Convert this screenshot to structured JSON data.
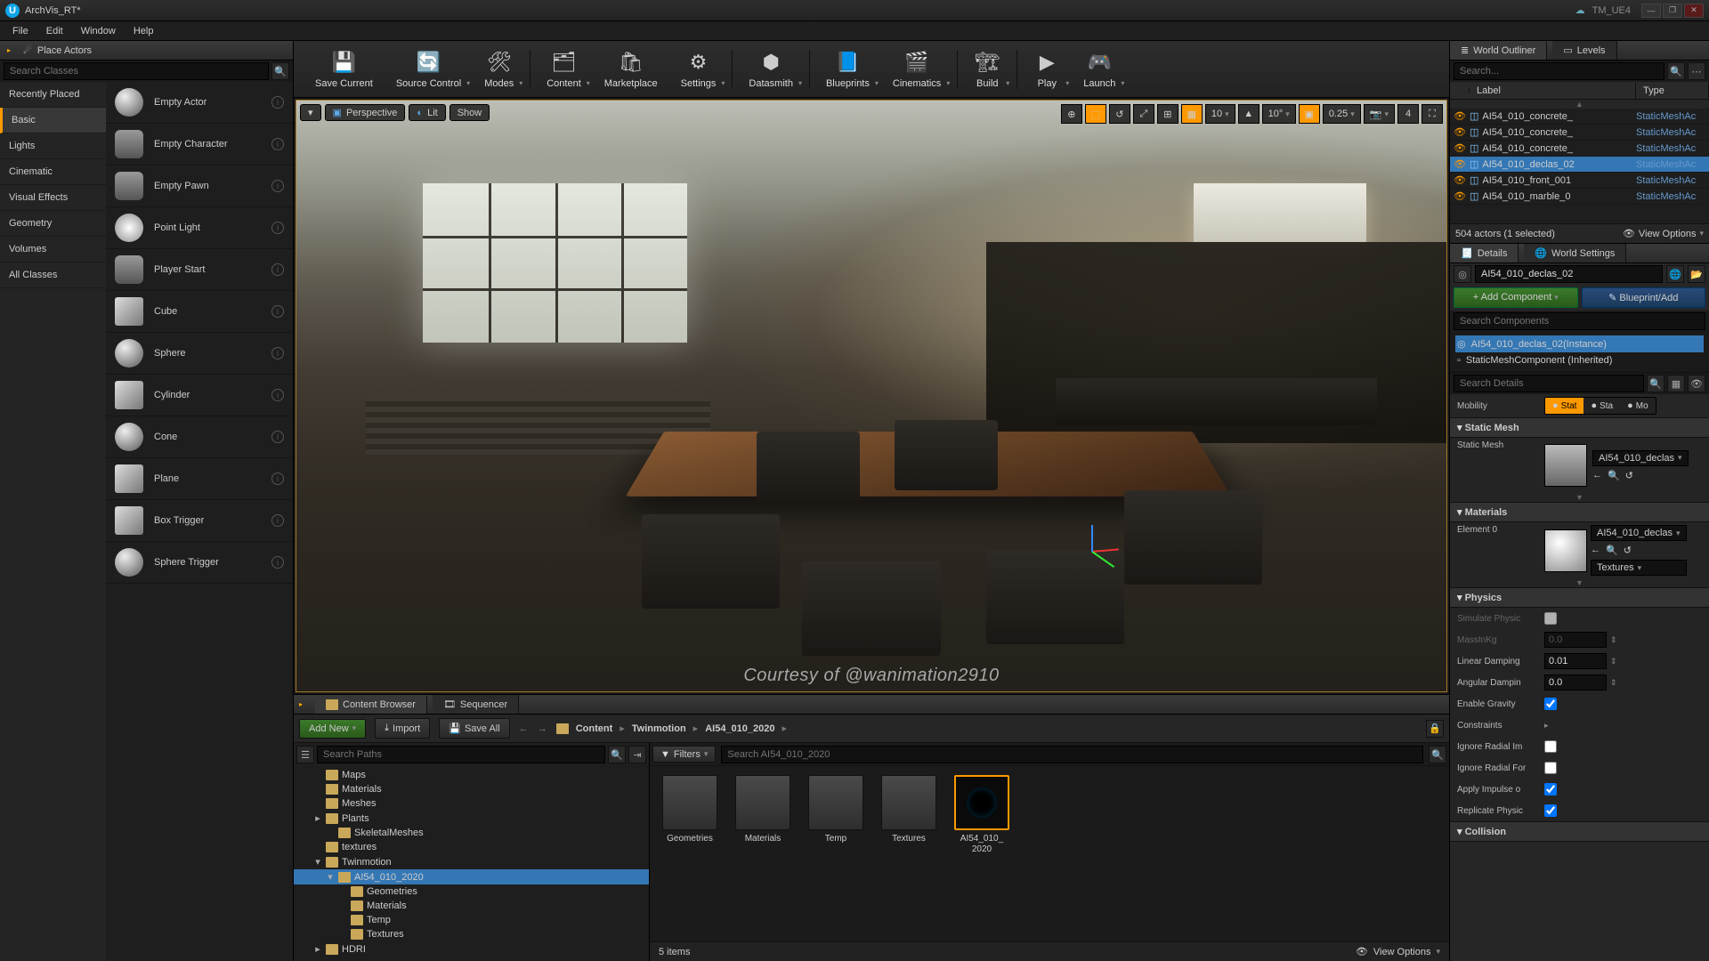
{
  "window": {
    "project": "ArchVis_RT*",
    "suite": "TM_UE4"
  },
  "menus": [
    "File",
    "Edit",
    "Window",
    "Help"
  ],
  "placeActors": {
    "title": "Place Actors",
    "searchPlaceholder": "Search Classes",
    "categories": [
      "Recently Placed",
      "Basic",
      "Lights",
      "Cinematic",
      "Visual Effects",
      "Geometry",
      "Volumes",
      "All Classes"
    ],
    "selectedCategory": "Basic",
    "items": [
      "Empty Actor",
      "Empty Character",
      "Empty Pawn",
      "Point Light",
      "Player Start",
      "Cube",
      "Sphere",
      "Cylinder",
      "Cone",
      "Plane",
      "Box Trigger",
      "Sphere Trigger"
    ]
  },
  "toolbar": [
    {
      "label": "Save Current",
      "icon": "💾"
    },
    {
      "label": "Source Control",
      "icon": "🔄",
      "dd": true
    },
    {
      "label": "Modes",
      "icon": "🛠",
      "dd": true,
      "sepAfter": true
    },
    {
      "label": "Content",
      "icon": "🗂",
      "dd": true
    },
    {
      "label": "Marketplace",
      "icon": "🛍"
    },
    {
      "label": "Settings",
      "icon": "⚙",
      "dd": true,
      "sepAfter": true
    },
    {
      "label": "Datasmith",
      "icon": "⬢",
      "dd": true,
      "sepAfter": true
    },
    {
      "label": "Blueprints",
      "icon": "📘",
      "dd": true
    },
    {
      "label": "Cinematics",
      "icon": "🎬",
      "dd": true,
      "sepAfter": true
    },
    {
      "label": "Build",
      "icon": "🏗",
      "dd": true,
      "sepAfter": true
    },
    {
      "label": "Play",
      "icon": "▶",
      "dd": true
    },
    {
      "label": "Launch",
      "icon": "🎮",
      "dd": true
    }
  ],
  "viewport": {
    "menu": "▾",
    "perspective": "Perspective",
    "lit": "Lit",
    "show": "Show",
    "right": [
      {
        "t": "⊕"
      },
      {
        "t": "⬚",
        "on": true
      },
      {
        "t": "↺"
      },
      {
        "t": "⤢"
      },
      {
        "t": "⊞"
      },
      {
        "t": "▦",
        "on": true
      },
      {
        "t": "10",
        "dd": true
      },
      {
        "t": "▲"
      },
      {
        "t": "10°",
        "dd": true
      },
      {
        "t": "▣",
        "on": true
      },
      {
        "t": "0.25",
        "dd": true
      },
      {
        "t": "📷",
        "dd": true
      },
      {
        "t": "4"
      },
      {
        "t": "⛶"
      }
    ]
  },
  "outliner": {
    "title": "World Outliner",
    "levelsTab": "Levels",
    "searchPlaceholder": "Search...",
    "cols": [
      "Label",
      "Type"
    ],
    "rows": [
      {
        "label": "AI54_010_concrete_",
        "type": "StaticMeshAc"
      },
      {
        "label": "AI54_010_concrete_",
        "type": "StaticMeshAc"
      },
      {
        "label": "AI54_010_concrete_",
        "type": "StaticMeshAc"
      },
      {
        "label": "AI54_010_declas_02",
        "type": "StaticMeshAc",
        "sel": true
      },
      {
        "label": "AI54_010_front_001",
        "type": "StaticMeshAc"
      },
      {
        "label": "AI54_010_marble_0",
        "type": "StaticMeshAc"
      }
    ],
    "status": "504 actors (1 selected)",
    "viewOptions": "View Options"
  },
  "details": {
    "tab": "Details",
    "worldTab": "World Settings",
    "actorName": "AI54_010_declas_02",
    "addComponent": "+ Add Component",
    "blueprint": "Blueprint/Add",
    "searchCompPlaceholder": "Search Components",
    "components": [
      {
        "name": "AI54_010_declas_02(Instance)",
        "sel": true
      },
      {
        "name": "StaticMeshComponent (Inherited)"
      }
    ],
    "searchDetailsPlaceholder": "Search Details",
    "mobility": {
      "label": "Mobility",
      "opts": [
        "Stat",
        "Sta",
        "Mo"
      ],
      "sel": 0
    },
    "staticMesh": {
      "section": "Static Mesh",
      "label": "Static Mesh",
      "value": "AI54_010_declas"
    },
    "materials": {
      "section": "Materials",
      "label": "Element 0",
      "value": "AI54_010_declas",
      "textures": "Textures"
    },
    "physics": {
      "section": "Physics",
      "props": [
        {
          "k": "Simulate Physic",
          "type": "check",
          "v": false,
          "dis": true
        },
        {
          "k": "MassInKg",
          "type": "num",
          "v": "0.0",
          "dis": true
        },
        {
          "k": "Linear Damping",
          "type": "num",
          "v": "0.01"
        },
        {
          "k": "Angular Dampin",
          "type": "num",
          "v": "0.0"
        },
        {
          "k": "Enable Gravity",
          "type": "check",
          "v": true
        },
        {
          "k": "Constraints",
          "type": "expand"
        },
        {
          "k": "Ignore Radial Im",
          "type": "check",
          "v": false
        },
        {
          "k": "Ignore Radial For",
          "type": "check",
          "v": false
        },
        {
          "k": "Apply Impulse o",
          "type": "check",
          "v": true
        },
        {
          "k": "Replicate Physic",
          "type": "check",
          "v": true
        }
      ]
    },
    "collision": {
      "section": "Collision"
    }
  },
  "contentBrowser": {
    "tab": "Content Browser",
    "seqTab": "Sequencer",
    "addNew": "Add New",
    "import": "Import",
    "saveAll": "Save All",
    "path": [
      "Content",
      "Twinmotion",
      "AI54_010_2020"
    ],
    "searchPathsPlaceholder": "Search Paths",
    "tree": [
      {
        "d": 1,
        "n": "Maps"
      },
      {
        "d": 1,
        "n": "Materials"
      },
      {
        "d": 1,
        "n": "Meshes"
      },
      {
        "d": 1,
        "n": "Plants",
        "exp": true
      },
      {
        "d": 2,
        "n": "SkeletalMeshes"
      },
      {
        "d": 1,
        "n": "textures"
      },
      {
        "d": 1,
        "n": "Twinmotion",
        "exp": true,
        "open": true
      },
      {
        "d": 2,
        "n": "AI54_010_2020",
        "exp": true,
        "open": true,
        "sel": true
      },
      {
        "d": 3,
        "n": "Geometries"
      },
      {
        "d": 3,
        "n": "Materials"
      },
      {
        "d": 3,
        "n": "Temp"
      },
      {
        "d": 3,
        "n": "Textures"
      },
      {
        "d": 1,
        "n": "HDRI",
        "exp": true
      }
    ],
    "filtersLabel": "Filters",
    "assetSearchPlaceholder": "Search AI54_010_2020",
    "assets": [
      {
        "n": "Geometries",
        "folder": true
      },
      {
        "n": "Materials",
        "folder": true
      },
      {
        "n": "Temp",
        "folder": true
      },
      {
        "n": "Textures",
        "folder": true
      },
      {
        "n": "AI54_010_2020",
        "folder": false,
        "sel": true
      }
    ],
    "status": "5 items",
    "viewOptions": "View Options"
  },
  "courtesy": "Courtesy of @wanimation2910"
}
